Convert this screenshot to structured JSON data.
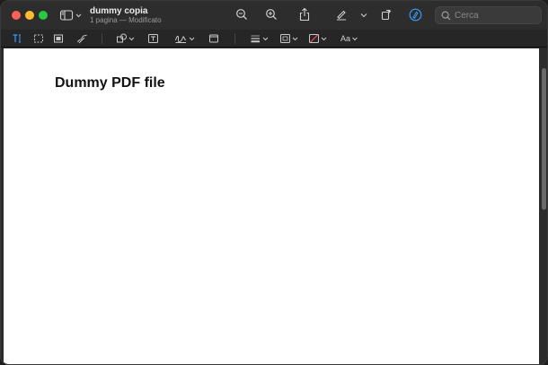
{
  "document": {
    "title": "dummy copia",
    "subtitle": "1 pagina — Modificato"
  },
  "search": {
    "placeholder": "Cerca"
  },
  "markup": {
    "font_label": "Aa"
  },
  "pdf": {
    "heading": "Dummy PDF file"
  },
  "colors": {
    "close": "#ff5f57",
    "minimize": "#febc2e",
    "maximize": "#28c840",
    "accent": "#3b9cff"
  }
}
